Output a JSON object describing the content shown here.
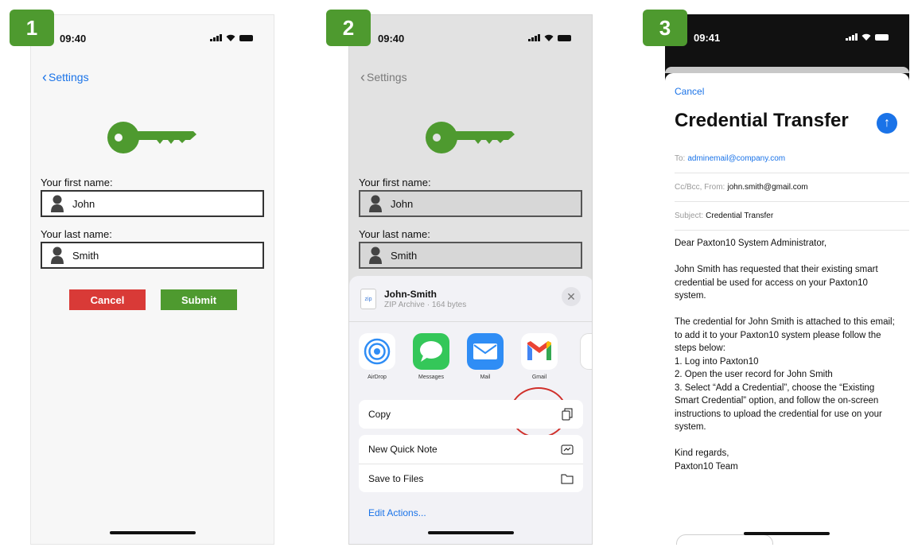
{
  "steps": [
    "1",
    "2",
    "3"
  ],
  "status": {
    "time_1": "09:40",
    "time_2": "09:40",
    "time_3": "09:41"
  },
  "app_form": {
    "back_label": "Settings",
    "first_name_label": "Your first name:",
    "first_name_value": "John",
    "last_name_label": "Your last name:",
    "last_name_value": "Smith",
    "cancel_label": "Cancel",
    "submit_label": "Submit",
    "key_color": "#4e9a2f",
    "cancel_color": "#d93a37",
    "submit_color": "#4e9a2f"
  },
  "share_sheet": {
    "file_name": "John-Smith",
    "file_info": "ZIP Archive · 164 bytes",
    "file_type_badge": "zip",
    "apps": [
      {
        "label": "AirDrop",
        "icon": "airdrop-icon"
      },
      {
        "label": "Messages",
        "icon": "messages-icon"
      },
      {
        "label": "Mail",
        "icon": "mail-icon"
      },
      {
        "label": "Gmail",
        "icon": "gmail-icon"
      }
    ],
    "actions": {
      "copy": "Copy",
      "quick_note": "New Quick Note",
      "save_files": "Save to Files",
      "edit": "Edit Actions..."
    }
  },
  "email": {
    "cancel_label": "Cancel",
    "subject_heading": "Credential Transfer",
    "to_label": "To:",
    "to_value": "adminemail@company.com",
    "cc_label": "Cc/Bcc, From:",
    "cc_value": "john.smith@gmail.com",
    "subject_label": "Subject:",
    "subject_value": "Credential Transfer",
    "body": {
      "greeting": "Dear Paxton10 System Administrator,",
      "para1": "John Smith has requested that their existing smart credential be used for access on your Paxton10 system.",
      "para2": "The credential for John Smith is attached to this email; to add it to your Paxton10 system please follow the steps below:",
      "step1": "1. Log into Paxton10",
      "step2": "2. Open the user record for John Smith",
      "step3": "3. Select “Add a Credential”, choose the “Existing Smart Credential” option, and follow the on-screen instructions to upload the credential for use on your system.",
      "signoff": "Kind regards,",
      "team": "Paxton10 Team"
    }
  }
}
